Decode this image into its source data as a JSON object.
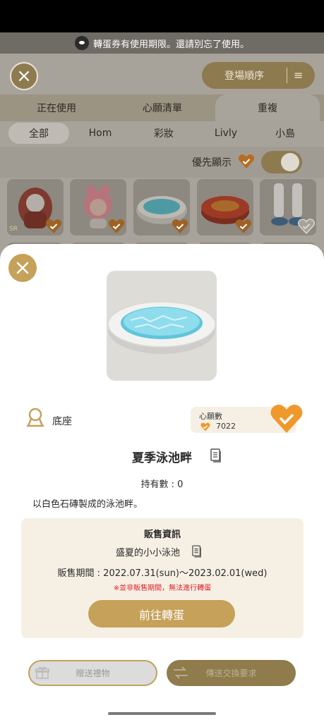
{
  "notice": {
    "text": "轉蛋券有使用期限。還請別忘了使用。"
  },
  "toolbar": {
    "sort_label": "登場順序"
  },
  "tabs_primary": [
    {
      "label": "正在使用"
    },
    {
      "label": "心願清單"
    },
    {
      "label": "重複"
    }
  ],
  "tabs_secondary": [
    {
      "label": "全部"
    },
    {
      "label": "Hom"
    },
    {
      "label": "彩妝"
    },
    {
      "label": "Livly"
    },
    {
      "label": "小島"
    }
  ],
  "priority": {
    "label": "優先顯示",
    "enabled": true
  },
  "grid_badges": {
    "sr_label": "SR"
  },
  "detail": {
    "category_label": "底座",
    "wish_label": "心願數",
    "wish_count": "7022",
    "item_name": "夏季泳池畔",
    "owned_text": "持有數 : 0",
    "description": "以白色石磚製成的泳池畔。",
    "sales": {
      "header": "販售資訊",
      "package": "盛夏的小小泳池",
      "period": "販售期間 : 2022.07.31(sun)～2023.02.01(wed)",
      "warning": "※並非販售期間，無法進行轉蛋",
      "go_button": "前往轉蛋"
    },
    "gift_button": "贈送禮物",
    "trade_button": "傳送交換要求"
  },
  "colors": {
    "gold": "#c5a15a",
    "heart_orange": "#f0982c",
    "warning_red": "#e0202a",
    "panel_cream": "#f6f0e4"
  }
}
